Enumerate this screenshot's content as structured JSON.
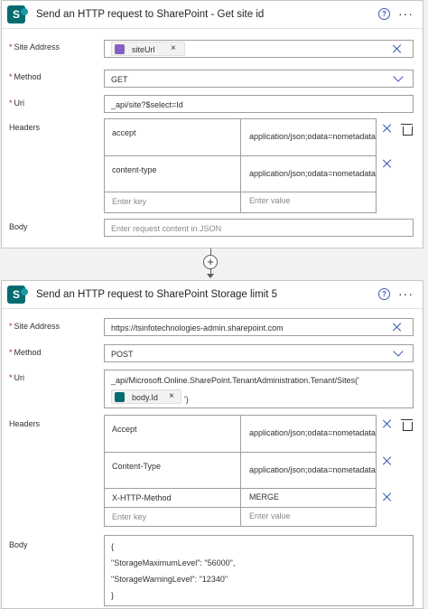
{
  "card1": {
    "title": "Send an HTTP request to SharePoint - Get site id",
    "site_address_label": "Site Address",
    "site_token": "siteUrl",
    "method_label": "Method",
    "method_value": "GET",
    "uri_label": "Uri",
    "uri_value": "_api/site?$select=Id",
    "headers_label": "Headers",
    "headers": [
      {
        "key": "accept",
        "value": "application/json;odata=nometadata"
      },
      {
        "key": "content-type",
        "value": "application/json;odata=nometadata"
      }
    ],
    "key_placeholder": "Enter key",
    "value_placeholder": "Enter value",
    "body_label": "Body",
    "body_placeholder": "Enter request content in JSON"
  },
  "card2": {
    "title": "Send an HTTP request to SharePoint Storage limit 5",
    "site_address_label": "Site Address",
    "site_address_value": "https://tsinfotechnologies-admin.sharepoint.com",
    "method_label": "Method",
    "method_value": "POST",
    "uri_label": "Uri",
    "uri_value": "_api/Microsoft.Online.SharePoint.TenantAdministration.Tenant/Sites('",
    "uri_token": "body.Id",
    "uri_suffix": "')",
    "headers_label": "Headers",
    "headers": [
      {
        "key": "Accept",
        "value": "application/json;odata=nometadata"
      },
      {
        "key": "Content-Type",
        "value": "application/json;odata=nometadata"
      },
      {
        "key": "X-HTTP-Method",
        "value": "MERGE"
      }
    ],
    "key_placeholder": "Enter key",
    "value_placeholder": "Enter value",
    "body_label": "Body",
    "body_lines": [
      "{",
      "\"StorageMaximumLevel\": \"56000\",",
      "\"StorageWarningLevel\": \"12340\"",
      "}"
    ]
  },
  "icons": {
    "sharepoint": "S",
    "help": "?",
    "more": "···",
    "add": "+",
    "token_x": "×"
  },
  "colors": {
    "accent": "#3b56b4",
    "sharepoint": "#036c70",
    "expression_token": "#8661c5",
    "required": "#a4262c"
  }
}
